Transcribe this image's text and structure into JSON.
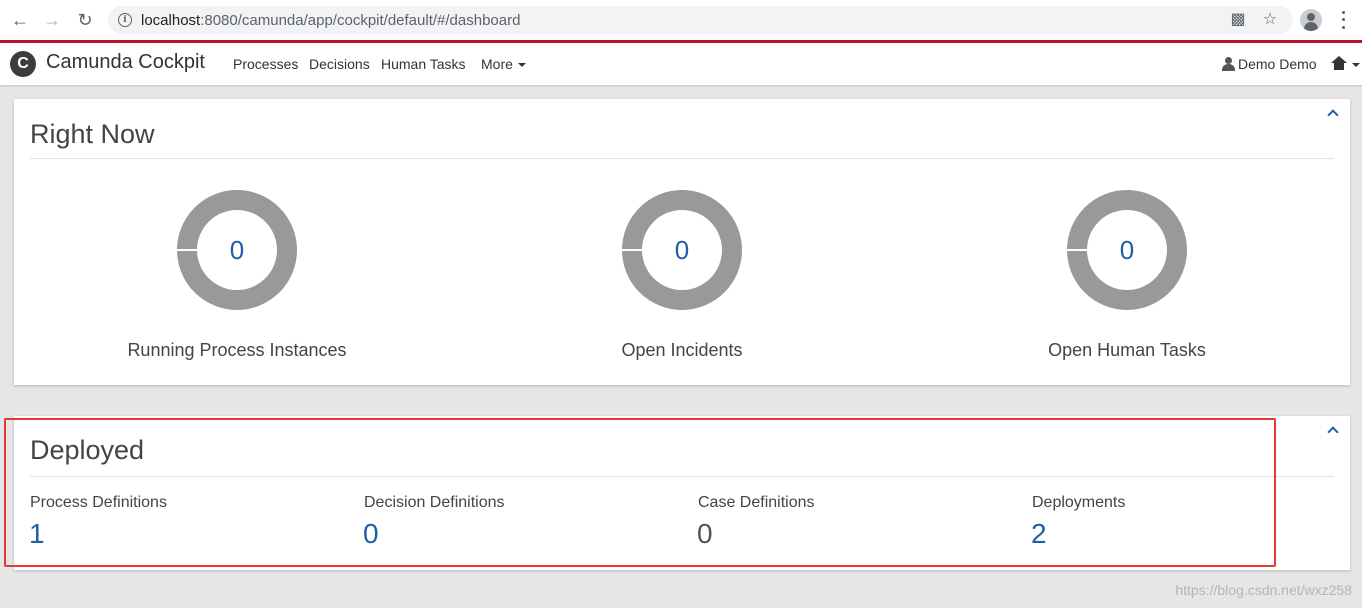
{
  "browser": {
    "url_host": "localhost",
    "url_rest": ":8080/camunda/app/cockpit/default/#/dashboard"
  },
  "header": {
    "logo_letter": "C",
    "brand": "Camunda Cockpit",
    "nav": [
      "Processes",
      "Decisions",
      "Human Tasks",
      "More"
    ],
    "user": "Demo Demo"
  },
  "right_now": {
    "title": "Right Now",
    "stats": [
      {
        "value": "0",
        "label": "Running Process Instances"
      },
      {
        "value": "0",
        "label": "Open Incidents"
      },
      {
        "value": "0",
        "label": "Open Human Tasks"
      }
    ]
  },
  "deployed": {
    "title": "Deployed",
    "items": [
      {
        "label": "Process Definitions",
        "value": "1"
      },
      {
        "label": "Decision Definitions",
        "value": "0"
      },
      {
        "label": "Case Definitions",
        "value": "0"
      },
      {
        "label": "Deployments",
        "value": "2"
      }
    ]
  },
  "watermark": "https://blog.csdn.net/wxz258",
  "colors": {
    "accent": "#1f5ea8",
    "header_border": "#b5152b",
    "donut": "#999999",
    "highlight": "#e53935"
  }
}
